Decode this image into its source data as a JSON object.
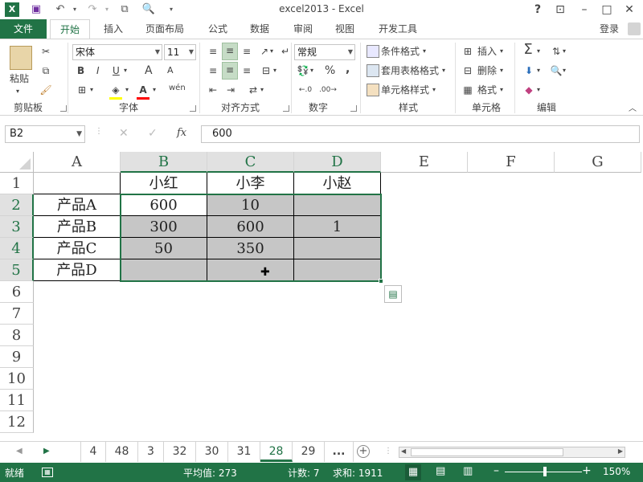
{
  "app": {
    "title": "excel2013 - Excel",
    "help": "?",
    "login": "登录"
  },
  "ribbon_tabs": [
    "文件",
    "开始",
    "插入",
    "页面布局",
    "公式",
    "数据",
    "审阅",
    "视图",
    "开发工具"
  ],
  "ribbon": {
    "clipboard": {
      "label": "剪贴板",
      "paste": "粘贴"
    },
    "font": {
      "label": "字体",
      "name": "宋体",
      "size": "11",
      "bold": "B",
      "italic": "I",
      "underline": "U",
      "grow": "A",
      "shrink": "A",
      "wen": "wén"
    },
    "alignment": {
      "label": "对齐方式"
    },
    "number": {
      "label": "数字",
      "format": "常规",
      "percent": "%",
      "comma": ","
    },
    "styles": {
      "label": "样式",
      "cond": "条件格式",
      "table": "套用表格格式",
      "cell": "单元格样式"
    },
    "cells": {
      "label": "单元格",
      "insert": "插入",
      "delete": "删除",
      "format": "格式"
    },
    "editing": {
      "label": "编辑"
    }
  },
  "formula_bar": {
    "name_box": "B2",
    "fx": "fx",
    "value": "600"
  },
  "columns": [
    "A",
    "B",
    "C",
    "D",
    "E",
    "F",
    "G"
  ],
  "rows": [
    "1",
    "2",
    "3",
    "4",
    "5",
    "6",
    "7",
    "8",
    "9",
    "10",
    "11",
    "12"
  ],
  "cells": {
    "B1": "小红",
    "C1": "小李",
    "D1": "小赵",
    "A2": "产品A",
    "B2": "600",
    "C2": "10",
    "D2": "",
    "A3": "产品B",
    "B3": "300",
    "C3": "600",
    "D3": "1",
    "A4": "产品C",
    "B4": "50",
    "C4": "350",
    "D4": "",
    "A5": "产品D",
    "B5": "",
    "C5": "",
    "D5": ""
  },
  "sheet_tabs": [
    "4",
    "48",
    "3",
    "32",
    "30",
    "31",
    "28",
    "29",
    "..."
  ],
  "active_sheet": "28",
  "status": {
    "ready": "就绪",
    "average": "平均值: 273",
    "count": "计数: 7",
    "sum": "求和: 1911",
    "zoom": "150%"
  },
  "colors": {
    "accent": "#217346",
    "selection_fill": "#c6c6c6"
  }
}
